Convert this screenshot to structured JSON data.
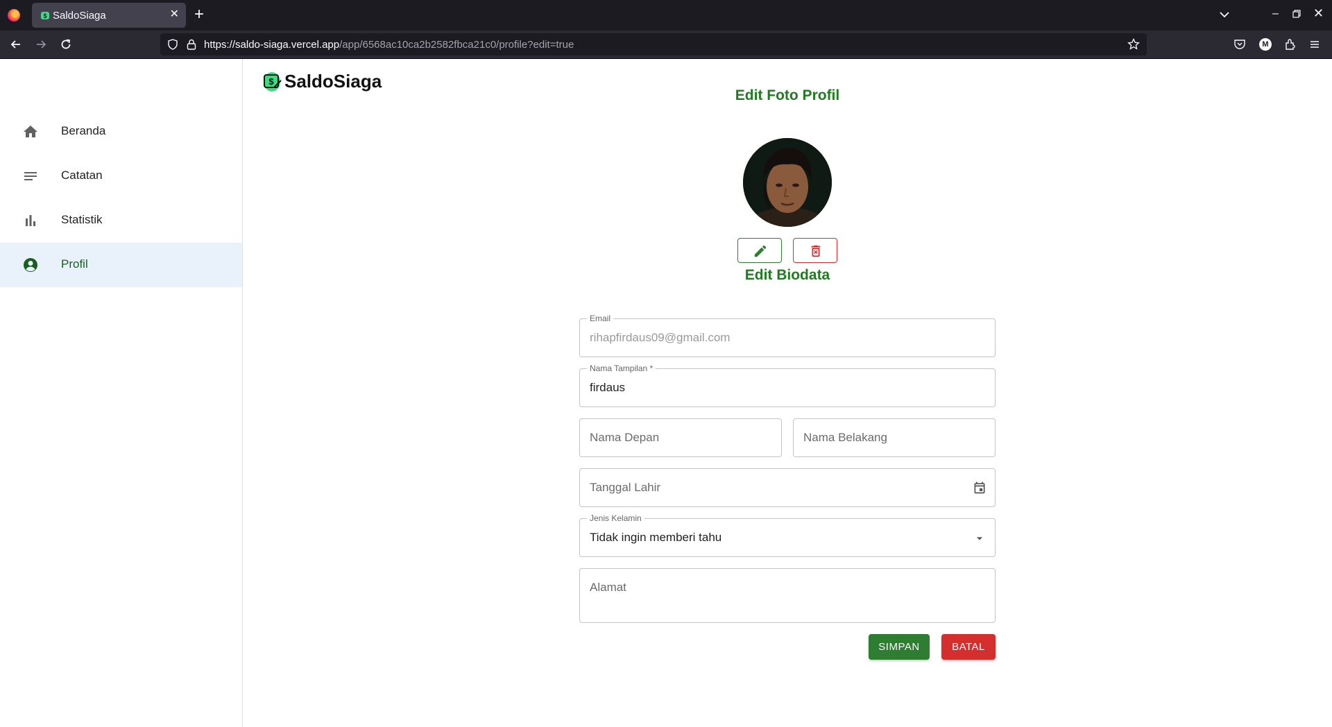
{
  "browser": {
    "tab_title": "SaldoSiaga",
    "url_host": "https://saldo-siaga.vercel.app",
    "url_path": "/app/6568ac10ca2b2582fbca21c0/profile?edit=true",
    "account_initial": "M"
  },
  "app": {
    "brand_name": "SaldoSiaga",
    "accent_color": "#2e7d32",
    "danger_color": "#d32f2f"
  },
  "sidebar": {
    "items": [
      {
        "label": "Beranda",
        "icon": "home-icon",
        "active": false
      },
      {
        "label": "Catatan",
        "icon": "notes-icon",
        "active": false
      },
      {
        "label": "Statistik",
        "icon": "bar-chart-icon",
        "active": false
      },
      {
        "label": "Profil",
        "icon": "account-circle-icon",
        "active": true
      }
    ]
  },
  "photo_section": {
    "title": "Edit Foto Profil"
  },
  "biodata": {
    "title": "Edit Biodata",
    "email": {
      "label": "Email",
      "value": "rihapfirdaus09@gmail.com"
    },
    "display_name": {
      "label": "Nama Tampilan *",
      "value": "firdaus"
    },
    "first_name": {
      "placeholder": "Nama Depan"
    },
    "last_name": {
      "placeholder": "Nama Belakang"
    },
    "birth_date": {
      "placeholder": "Tanggal Lahir"
    },
    "gender": {
      "label": "Jenis Kelamin",
      "value": "Tidak ingin memberi tahu"
    },
    "address": {
      "placeholder": "Alamat"
    }
  },
  "actions": {
    "save_label": "SIMPAN",
    "cancel_label": "BATAL"
  }
}
